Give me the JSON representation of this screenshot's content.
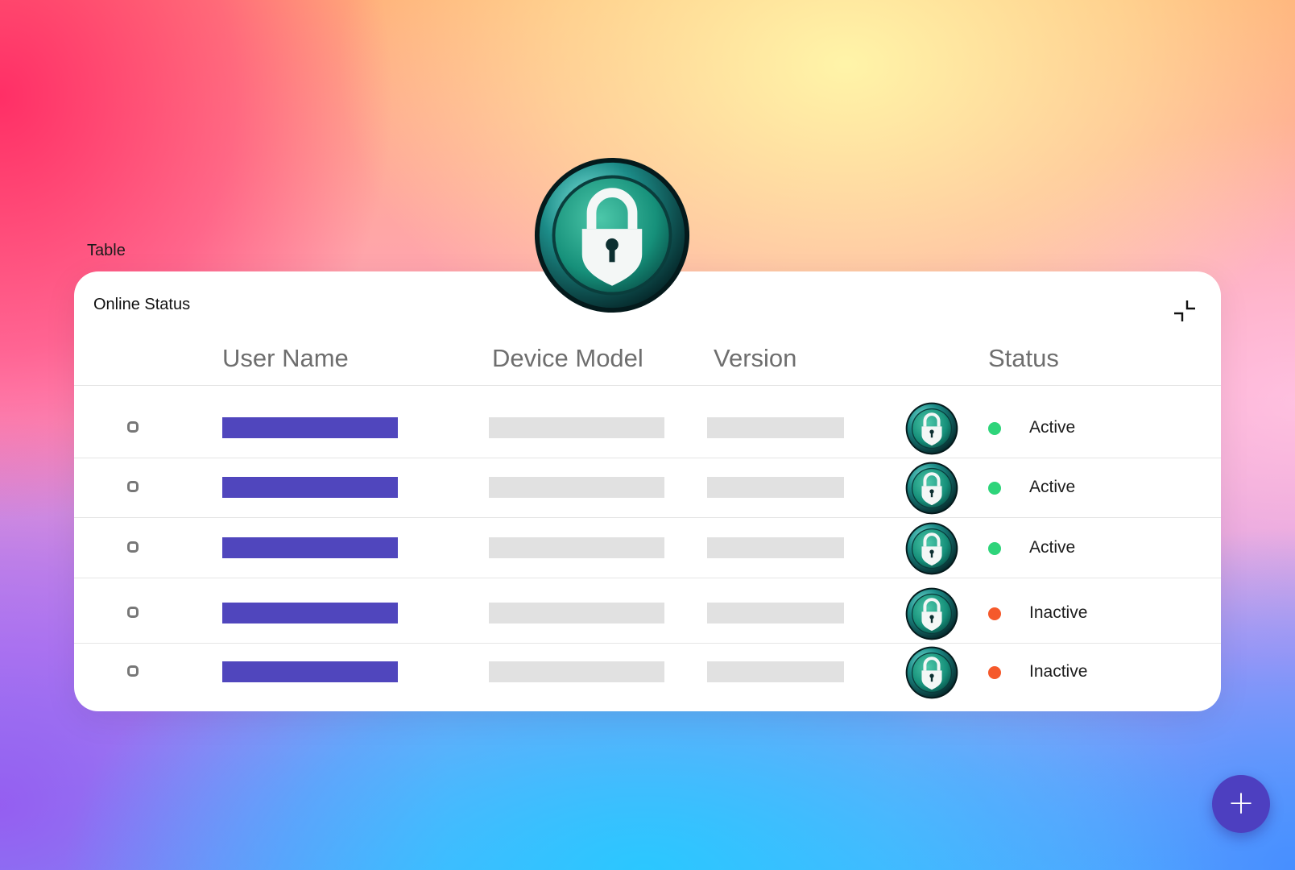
{
  "section_label": "Table",
  "card": {
    "title": "Online Status",
    "collapse_icon": "collapse-icon"
  },
  "hero_icon": "lock-icon",
  "columns": [
    "User Name",
    "Device Model",
    "Version",
    "Status"
  ],
  "rows": [
    {
      "status": "Active",
      "status_color": "#2ed47a"
    },
    {
      "status": "Active",
      "status_color": "#2ed47a"
    },
    {
      "status": "Active",
      "status_color": "#2ed47a"
    },
    {
      "status": "Inactive",
      "status_color": "#f5592b"
    },
    {
      "status": "Inactive",
      "status_color": "#f5592b"
    }
  ],
  "fab": {
    "label": "+"
  },
  "colors": {
    "accent": "#4d3fc0",
    "name_placeholder": "#5046bd",
    "placeholder": "#e1e1e1",
    "active": "#2ed47a",
    "inactive": "#f5592b"
  }
}
